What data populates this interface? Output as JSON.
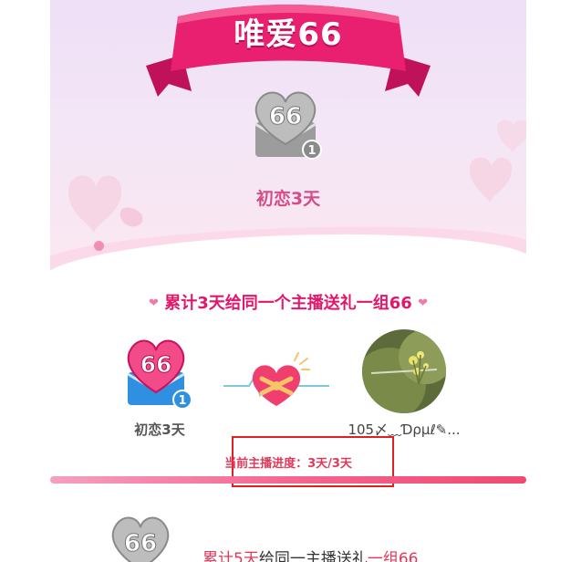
{
  "banner": {
    "title": "唯爱66"
  },
  "main_badge": {
    "number": "66",
    "level": "1",
    "label": "初恋3天"
  },
  "task": {
    "heart_symbol": "❤",
    "title": "累计3天给同一个主播送礼一组66"
  },
  "reward": {
    "badge_number": "66",
    "badge_level": "1",
    "badge_label": "初恋3天",
    "anchor_name": "105〆﹏Ɗρμℓ✎..."
  },
  "progress": {
    "label": "当前主播进度：",
    "value": "3天/3天",
    "fraction": 1.0
  },
  "next_task": {
    "badge_number": "66",
    "prefix": "累计5天",
    "middle": "给同一主播送礼",
    "suffix": "一组66"
  },
  "colors": {
    "accent_pink": "#e0176a",
    "ribbon": "#e91f6f",
    "highlight_box": "#e02020"
  }
}
